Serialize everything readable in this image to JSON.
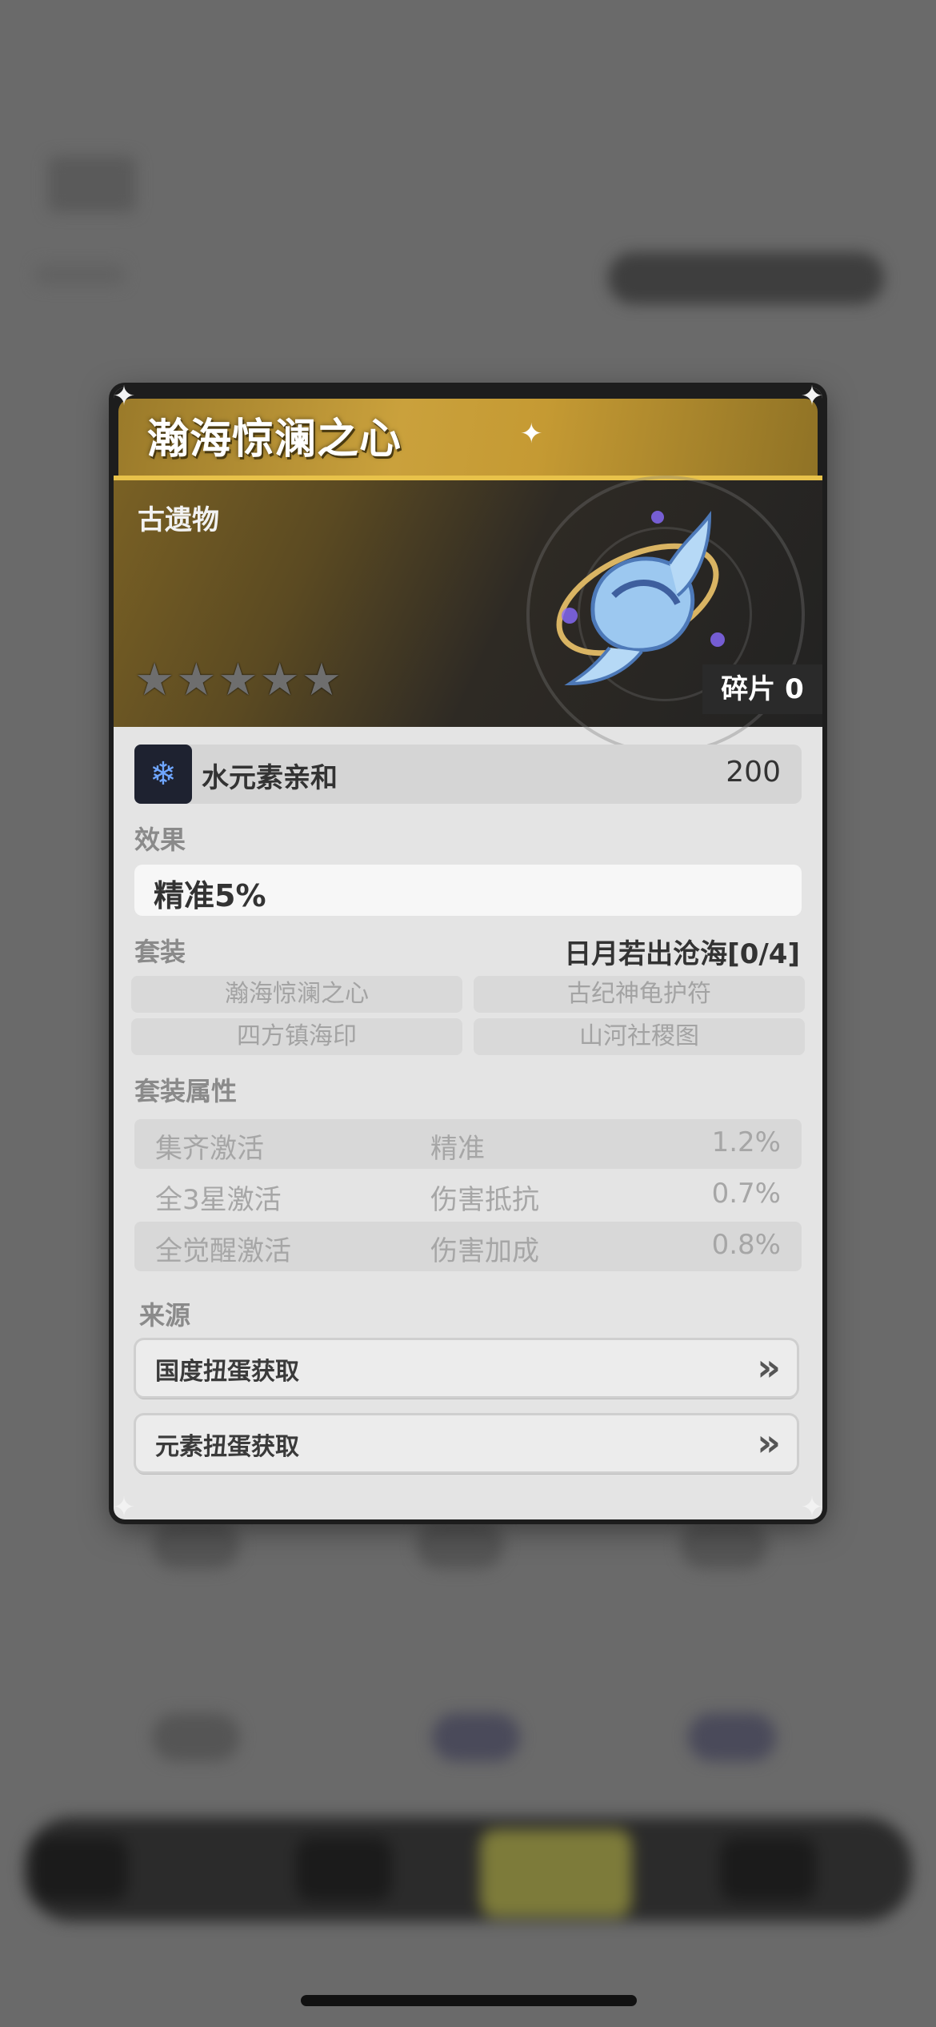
{
  "item": {
    "title": "瀚海惊澜之心",
    "category": "古遗物",
    "stars_filled": 0,
    "stars_total": 5,
    "fragments": "碎片 0"
  },
  "affinity": {
    "icon": "water-element-icon",
    "name": "水元素亲和",
    "value": "200"
  },
  "effect": {
    "label": "效果",
    "text": "精准5%"
  },
  "set": {
    "label": "套装",
    "name": "日月若出沧海[0/4]",
    "items": [
      "瀚海惊澜之心",
      "古纪神龟护符",
      "四方镇海印",
      "山河社稷图"
    ]
  },
  "set_attributes": {
    "label": "套装属性",
    "rows": [
      {
        "condition": "集齐激活",
        "stat": "精准",
        "value": "1.2%"
      },
      {
        "condition": "全3星激活",
        "stat": "伤害抵抗",
        "value": "0.7%"
      },
      {
        "condition": "全觉醒激活",
        "stat": "伤害加成",
        "value": "0.8%"
      }
    ]
  },
  "source": {
    "label": "来源",
    "buttons": [
      {
        "label": "国度扭蛋获取",
        "icon": "double-chevron-right-icon"
      },
      {
        "label": "元素扭蛋获取",
        "icon": "double-chevron-right-icon"
      }
    ]
  }
}
